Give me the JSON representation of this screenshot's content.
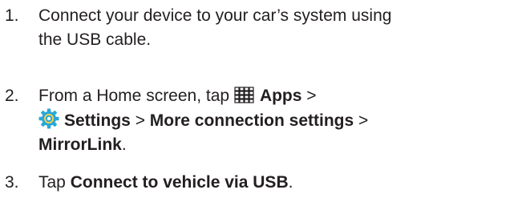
{
  "steps": [
    {
      "number": "1.",
      "line1": "Connect your device to your car’s system using",
      "line2": "the USB cable."
    },
    {
      "number": "2.",
      "prefix": "From a Home screen, tap",
      "apps_label": "Apps",
      "sep1": ">",
      "settings_label": "Settings",
      "sep2": ">",
      "more_label": "More connection settings",
      "sep3": ">",
      "mirrorlink_label": "MirrorLink",
      "period": ".",
      "apps_icon": "apps-grid-icon",
      "settings_icon": "settings-gear-icon"
    },
    {
      "number": "3.",
      "prefix": "Tap",
      "bold": "Connect to vehicle via USB",
      "period": "."
    }
  ],
  "colors": {
    "text": "#231f20",
    "settings_icon_primary": "#29a7d8",
    "settings_icon_secondary": "#ffd24a"
  }
}
